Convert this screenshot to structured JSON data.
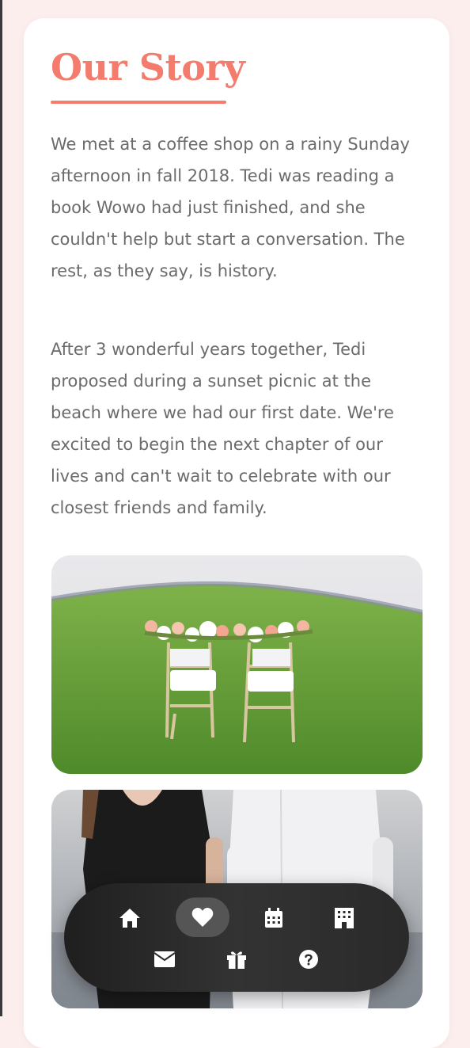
{
  "story": {
    "title": "Our Story",
    "paragraphs": [
      "We met at a coffee shop on a rainy Sunday afternoon in fall 2018. Tedi was reading a book Wowo had just finished, and she couldn't help but start a conversation. The rest, as they say, is history.",
      "After 3 wonderful years together, Tedi proposed during a sunset picnic at the beach where we had our first date. We're excited to begin the next chapter of our lives and can't wait to celebrate with our closest friends and family."
    ],
    "photos": [
      {
        "icon": "photo-wedding-chairs-on-lawn"
      },
      {
        "icon": "photo-couple-walking-on-beach"
      }
    ]
  },
  "nav": {
    "items": [
      {
        "icon": "home-icon",
        "active": false
      },
      {
        "icon": "heart-icon",
        "active": true
      },
      {
        "icon": "calendar-icon",
        "active": false
      },
      {
        "icon": "hotel-icon",
        "active": false
      },
      {
        "icon": "envelope-icon",
        "active": false
      },
      {
        "icon": "gift-icon",
        "active": false
      },
      {
        "icon": "question-icon",
        "active": false
      }
    ]
  },
  "colors": {
    "accent": "#f47c6c",
    "page_background": "#fdeeee",
    "card_background": "#ffffff",
    "body_text": "#6b6b6b",
    "nav_background": "#2a2a2a",
    "nav_active": "#555555"
  }
}
